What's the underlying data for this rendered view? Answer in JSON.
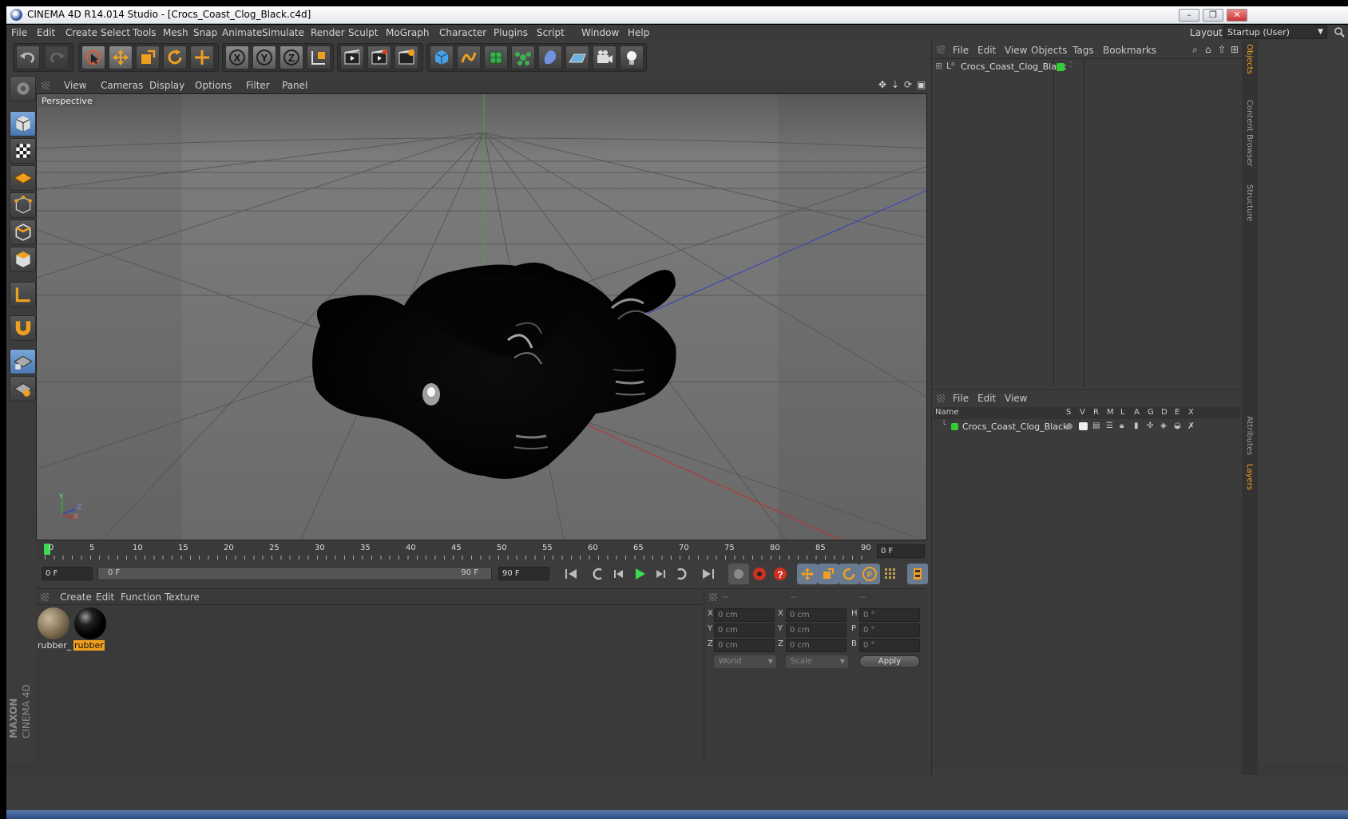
{
  "window": {
    "title": "CINEMA 4D R14.014 Studio - [Crocs_Coast_Clog_Black.c4d]"
  },
  "menubar": {
    "items": [
      "File",
      "Edit",
      "Create",
      "Select",
      "Tools",
      "Mesh",
      "Snap",
      "Animate",
      "Simulate",
      "Render",
      "Sculpt",
      "MoGraph",
      "Character",
      "Plugins",
      "Script",
      "Window",
      "Help"
    ],
    "layout_label": "Layout:",
    "layout_value": "Startup (User)"
  },
  "viewport": {
    "menu": [
      "View",
      "Cameras",
      "Display",
      "Options",
      "Filter",
      "Panel"
    ],
    "camera_label": "Perspective",
    "axis_y": "Y",
    "axis_z": "Z",
    "axis_x": "X"
  },
  "timeline": {
    "ticks": [
      "0",
      "5",
      "10",
      "15",
      "20",
      "25",
      "30",
      "35",
      "40",
      "45",
      "50",
      "55",
      "60",
      "65",
      "70",
      "75",
      "80",
      "85",
      "90"
    ],
    "current_frame": "0 F",
    "start_field": "0 F",
    "range_start": "0 F",
    "range_end": "90 F",
    "end_field": "90 F"
  },
  "materials": {
    "menu": [
      "Create",
      "Edit",
      "Function",
      "Texture"
    ],
    "items": [
      {
        "label": "rubber_"
      },
      {
        "label": "rubber"
      }
    ]
  },
  "coordinates": {
    "headers": [
      "--",
      "--",
      "--"
    ],
    "rows": [
      {
        "a": "X",
        "av": "0 cm",
        "b": "X",
        "bv": "0 cm",
        "c": "H",
        "cv": "0 °"
      },
      {
        "a": "Y",
        "av": "0 cm",
        "b": "Y",
        "bv": "0 cm",
        "c": "P",
        "cv": "0 °"
      },
      {
        "a": "Z",
        "av": "0 cm",
        "b": "Z",
        "bv": "0 cm",
        "c": "B",
        "cv": "0 °"
      }
    ],
    "mode1": "World",
    "mode2": "Scale",
    "apply": "Apply"
  },
  "objects": {
    "menu": [
      "File",
      "Edit",
      "View",
      "Objects",
      "Tags",
      "Bookmarks"
    ],
    "items": [
      "Crocs_Coast_Clog_Black"
    ]
  },
  "layers": {
    "menu": [
      "File",
      "Edit",
      "View"
    ],
    "columns": [
      "Name",
      "S",
      "V",
      "R",
      "M",
      "L",
      "A",
      "G",
      "D",
      "E",
      "X"
    ],
    "items": [
      "Crocs_Coast_Clog_Black"
    ]
  },
  "side_tabs": {
    "right_top": [
      "Objects",
      "Content Browser",
      "Structure"
    ],
    "right_bottom": [
      "Attributes",
      "Layers"
    ]
  },
  "brand": {
    "maxon": "MAXON",
    "product": "CINEMA 4D"
  },
  "colors": {
    "accent_orange": "#f0a020",
    "layer_green": "#33cc33",
    "grid_x": "#c03030",
    "grid_z": "#3040c0",
    "grid_y": "#30b030"
  }
}
